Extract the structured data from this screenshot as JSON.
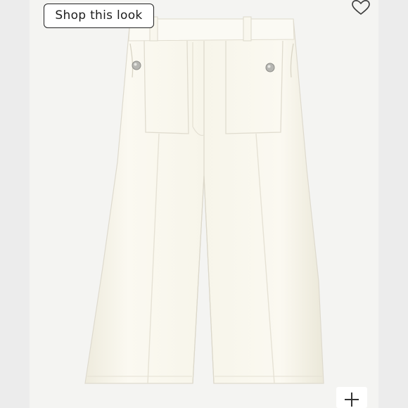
{
  "shop_button": {
    "label": "Shop this look"
  },
  "icons": {
    "favorite": "heart-outline-icon",
    "zoom": "plus-icon"
  },
  "colors": {
    "side_panel": "#ececec",
    "image_bg": "#f4f4f2",
    "garment": "#f8f6ec",
    "button_border": "#222222"
  }
}
